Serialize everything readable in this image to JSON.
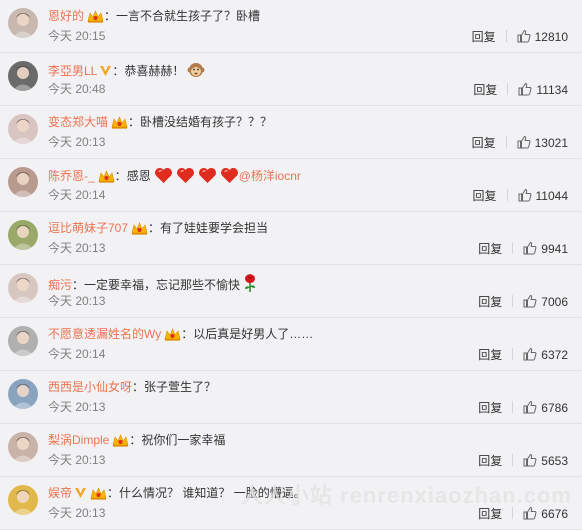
{
  "comments": [
    {
      "user": "恩好的",
      "badge": true,
      "verified": false,
      "text": "一言不合就生孩子了？卧槽",
      "emojis": [],
      "mention": "",
      "time": "今天 20:15",
      "reply": "回复",
      "likes": "12810",
      "avatar_color": "#c8b8b0"
    },
    {
      "user": "李亞男LL",
      "badge": false,
      "verified": true,
      "text": "恭喜赫赫！",
      "emojis": [
        "monkey-icon"
      ],
      "mention": "",
      "time": "今天 20:48",
      "reply": "回复",
      "likes": "11134",
      "avatar_color": "#6a6a6a"
    },
    {
      "user": "变态郑大喵",
      "badge": true,
      "verified": false,
      "text": "卧槽没结婚有孩子？？？",
      "emojis": [],
      "mention": "",
      "time": "今天 20:13",
      "reply": "回复",
      "likes": "13021",
      "avatar_color": "#d8c4c0"
    },
    {
      "user": "陈乔恩-_",
      "badge": true,
      "verified": false,
      "text": "感恩",
      "emojis": [
        "heart-icon",
        "heart-icon",
        "heart-icon",
        "heart-icon"
      ],
      "mention": "@杨洋iocnr",
      "time": "今天 20:14",
      "reply": "回复",
      "likes": "11044",
      "avatar_color": "#b89a8e"
    },
    {
      "user": "逗比萌妹子707",
      "badge": true,
      "verified": false,
      "text": "有了娃娃要学会担当",
      "emojis": [],
      "mention": "",
      "time": "今天 20:13",
      "reply": "回复",
      "likes": "9941",
      "avatar_color": "#9aa86a"
    },
    {
      "user": "痴污",
      "badge": false,
      "verified": false,
      "text": "一定要幸福，忘记那些不愉快",
      "emojis": [
        "rose-icon"
      ],
      "mention": "",
      "time": "今天 20:13",
      "reply": "回复",
      "likes": "7006",
      "avatar_color": "#d7c7c0"
    },
    {
      "user": "不愿意透漏姓名的Wy",
      "badge": true,
      "verified": false,
      "text": "以后真是好男人了……",
      "emojis": [],
      "mention": "",
      "time": "今天 20:14",
      "reply": "回复",
      "likes": "6372",
      "avatar_color": "#b0b0b0"
    },
    {
      "user": "西西是小仙女呀",
      "badge": false,
      "verified": false,
      "text": "张子萱生了？",
      "emojis": [],
      "mention": "",
      "time": "今天 20:13",
      "reply": "回复",
      "likes": "6786",
      "avatar_color": "#8aa4bf"
    },
    {
      "user": "梨涡Dimple",
      "badge": true,
      "verified": false,
      "text": "祝你们一家幸福",
      "emojis": [],
      "mention": "",
      "time": "今天 20:13",
      "reply": "回复",
      "likes": "5653",
      "avatar_color": "#c9b3a8"
    },
    {
      "user": "娱帝",
      "badge": true,
      "verified": true,
      "text": "什么情况？ 谁知道？ 一脸的懵逼。",
      "emojis": [],
      "mention": "",
      "time": "今天 20:13",
      "reply": "回复",
      "likes": "6676",
      "avatar_color": "#e0b94a"
    }
  ],
  "watermark": "人人小站 renrenxiaozhan.com",
  "colors": {
    "username": "#eb7350",
    "time": "#808080",
    "badge": "#f7b500",
    "vip": "#f5a623"
  }
}
